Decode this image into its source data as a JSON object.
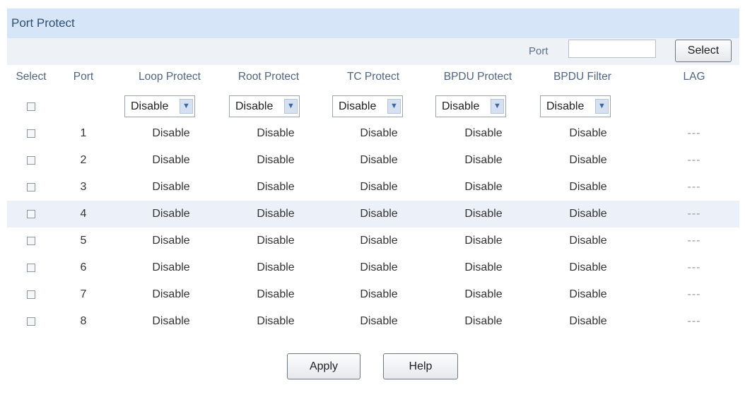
{
  "panel_title": "Port Protect",
  "port_search": {
    "label": "Port",
    "value": "",
    "button": "Select"
  },
  "columns": [
    "Select",
    "Port",
    "Loop Protect",
    "Root Protect",
    "TC Protect",
    "BPDU Protect",
    "BPDU Filter",
    "LAG"
  ],
  "filters": [
    "Disable",
    "Disable",
    "Disable",
    "Disable",
    "Disable"
  ],
  "rows": [
    {
      "port": "1",
      "loop": "Disable",
      "root": "Disable",
      "tc": "Disable",
      "bpdu_protect": "Disable",
      "bpdu_filter": "Disable",
      "lag": "---"
    },
    {
      "port": "2",
      "loop": "Disable",
      "root": "Disable",
      "tc": "Disable",
      "bpdu_protect": "Disable",
      "bpdu_filter": "Disable",
      "lag": "---"
    },
    {
      "port": "3",
      "loop": "Disable",
      "root": "Disable",
      "tc": "Disable",
      "bpdu_protect": "Disable",
      "bpdu_filter": "Disable",
      "lag": "---"
    },
    {
      "port": "4",
      "loop": "Disable",
      "root": "Disable",
      "tc": "Disable",
      "bpdu_protect": "Disable",
      "bpdu_filter": "Disable",
      "lag": "---"
    },
    {
      "port": "5",
      "loop": "Disable",
      "root": "Disable",
      "tc": "Disable",
      "bpdu_protect": "Disable",
      "bpdu_filter": "Disable",
      "lag": "---"
    },
    {
      "port": "6",
      "loop": "Disable",
      "root": "Disable",
      "tc": "Disable",
      "bpdu_protect": "Disable",
      "bpdu_filter": "Disable",
      "lag": "---"
    },
    {
      "port": "7",
      "loop": "Disable",
      "root": "Disable",
      "tc": "Disable",
      "bpdu_protect": "Disable",
      "bpdu_filter": "Disable",
      "lag": "---"
    },
    {
      "port": "8",
      "loop": "Disable",
      "root": "Disable",
      "tc": "Disable",
      "bpdu_protect": "Disable",
      "bpdu_filter": "Disable",
      "lag": "---"
    }
  ],
  "actions": {
    "apply": "Apply",
    "help": "Help"
  },
  "colors": {
    "title_bg": "#d6e6f8",
    "toolbar_bg": "#eef1f6",
    "header_text": "#4f6585",
    "highlight_row": "#ecf0f8"
  }
}
